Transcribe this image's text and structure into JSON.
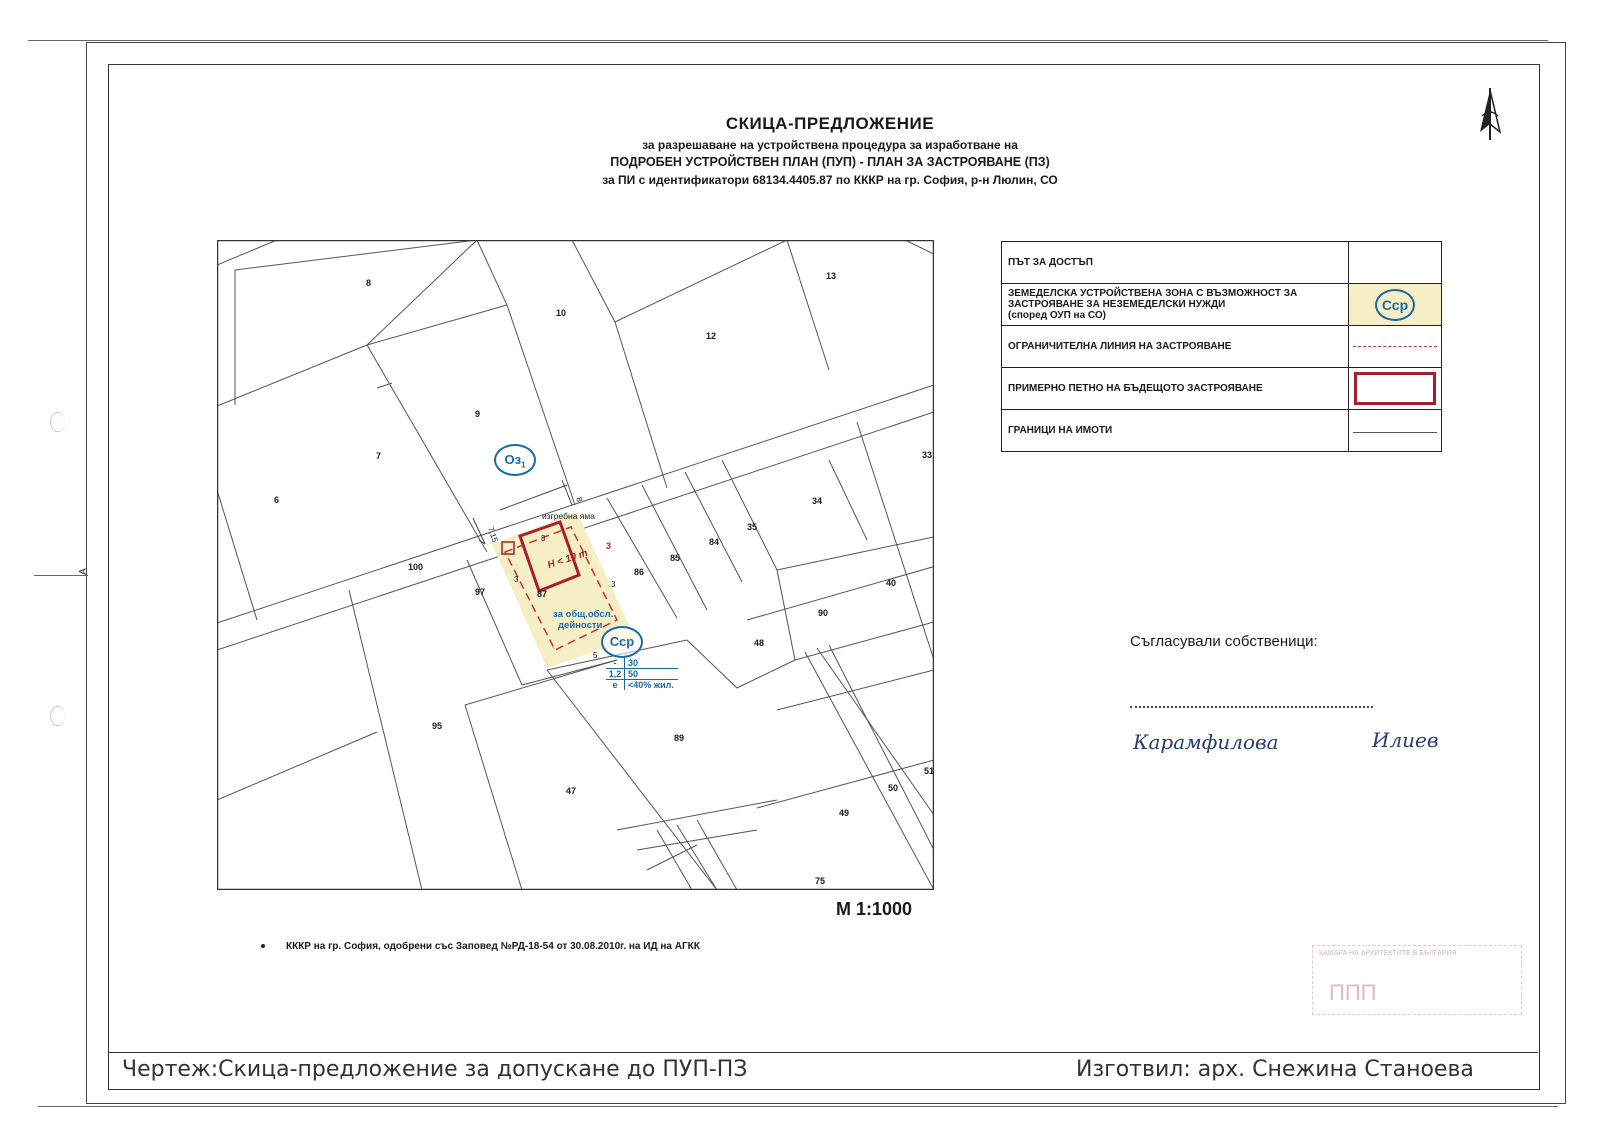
{
  "header": {
    "title": "СКИЦА-ПРЕДЛОЖЕНИЕ",
    "line2": "за разрешаване на устройствена процедура за изработване на",
    "line3": "ПОДРОБЕН УСТРОЙСТВЕН ПЛАН (ПУП) - ПЛАН ЗА ЗАСТРОЯВАНЕ (ПЗ)",
    "line4": "за ПИ с идентификатори 68134.4405.87 по КККР на гр. София, р-н Люлин, СО"
  },
  "legend": {
    "rows": [
      {
        "label": "ПЪТ ЗА ДОСТЪП",
        "symbol": "empty"
      },
      {
        "label": "ЗЕМЕДЕЛСКА УСТРОЙСТВЕНА ЗОНА С ВЪЗМОЖНОСТ ЗА ЗАСТРОЯВАНЕ ЗА НЕЗЕМЕДЕЛСКИ НУЖДИ",
        "sublabel": "(според ОУП на СО)",
        "symbol": "circle",
        "symbol_text": "Сср"
      },
      {
        "label": "ОГРАНИЧИТЕЛНА ЛИНИЯ НА ЗАСТРОЯВАНЕ",
        "symbol": "dashed-line"
      },
      {
        "label": "ПРИМЕРНО ПЕТНО НА БЪДЕЩОТО ЗАСТРОЯВАНЕ",
        "symbol": "rectangle"
      },
      {
        "label": "ГРАНИЦИ НА ИМОТИ",
        "symbol": "line"
      }
    ]
  },
  "map": {
    "parcels": [
      "8",
      "10",
      "13",
      "12",
      "9",
      "7",
      "6",
      "34",
      "35",
      "84",
      "85",
      "86",
      "100",
      "97",
      "87",
      "40",
      "90",
      "48",
      "95",
      "89",
      "47",
      "50",
      "49",
      "75",
      "33",
      "51"
    ],
    "zone_labels": {
      "oz": "Оз",
      "oz_sub": "1",
      "ccp": "Сср"
    },
    "annotations": {
      "pit": "изгребна яма",
      "height": "H < 10 m",
      "purpose_1": "за общ.обсл.",
      "purpose_2": "дейности",
      "dist_a": "7,15",
      "dist_b": "8",
      "d3a": "3",
      "d3b": "3",
      "d3c": "3",
      "d3d": "3",
      "d5": "5"
    },
    "indicators": {
      "row1_left": "-",
      "row1_right": "30",
      "row2_left": "1,2",
      "row2_right": "50",
      "row3_left": "e",
      "row3_right": "<40% жил."
    },
    "colors": {
      "zone_fill": "#f6efc6",
      "building": "#a6202c",
      "limit_line": "#c2363a",
      "zone_circle": "#1b6aa8",
      "boundary": "#555555"
    }
  },
  "scale": "М 1:1000",
  "note": "КККР на  гр. София, одобрени със Заповед №РД-18-54 от 30.08.2010г. на ИД на АГКК",
  "owners": {
    "title": "Съгласували собственици:",
    "signature_1": "Карамфилова",
    "signature_2": "Илиев"
  },
  "stamp": {
    "text": "КАМАРА НА АРХИТЕКТИТЕ В БЪЛГАРИЯ",
    "mark": "ППП"
  },
  "footer": {
    "drawing": "Чертеж:Скица-предложение за допускане до ПУП-ПЗ",
    "author": "Изготвил: арх. Снежина Станоева"
  },
  "side_marker": "А",
  "north_icon": "north-arrow-icon"
}
